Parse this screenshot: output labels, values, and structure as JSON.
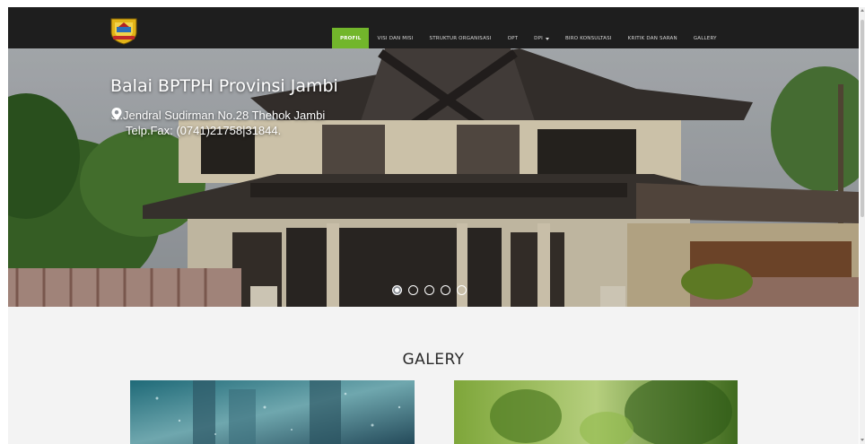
{
  "navbar": {
    "logo_icon": "jambi-province-emblem-icon",
    "items": [
      {
        "label": "PROFIL",
        "active": true
      },
      {
        "label": "VISI DAN MISI"
      },
      {
        "label": "STRUKTUR ORGANISASI"
      },
      {
        "label": "OPT"
      },
      {
        "label": "DPI",
        "has_dropdown": true
      },
      {
        "label": "BIRO KONSULTASI"
      },
      {
        "label": "KRITIK DAN SARAN"
      },
      {
        "label": "GALLERY"
      }
    ],
    "active_color": "#72b62b",
    "background": "#1e1e1e"
  },
  "hero": {
    "title": "Balai BPTPH Provinsi Jambi",
    "address_icon": "map-marker-icon",
    "address_line1": "Jl.Jendral Sudirman No.28 Thehok Jambi",
    "address_line2": "Telp.Fax: (0741)21758|31844.",
    "slides_count": 5,
    "active_slide": 1
  },
  "gallery": {
    "title": "GALERY"
  }
}
